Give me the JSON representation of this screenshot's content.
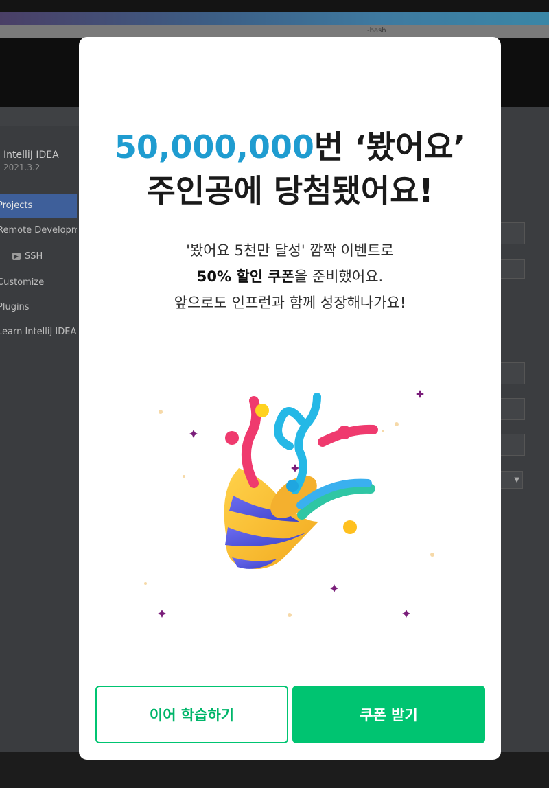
{
  "background": {
    "terminal_title": "-bash",
    "ide": {
      "product_name": "IntelliJ IDEA",
      "version": "2021.3.2",
      "nav_items": [
        {
          "label": "Projects",
          "active": true
        },
        {
          "label": "Remote Development"
        },
        {
          "label": "SSH",
          "icon": "ssh-icon"
        },
        {
          "label": "Customize"
        },
        {
          "label": "Plugins"
        },
        {
          "label": "Learn IntelliJ IDEA"
        }
      ]
    }
  },
  "modal": {
    "headline": {
      "count": "50,000,000",
      "line1_rest": "번 ‘봤어요’",
      "line2": "주인공에 당첨됐어요!"
    },
    "description": {
      "line1": "'봤어요 5천만 달성' 깜짝 이벤트로",
      "line2_bold": "50% 할인 쿠폰",
      "line2_rest": "을 준비했어요.",
      "line3": "앞으로도 인프런과 함께 성장해나가요!"
    },
    "illustration_icon": "party-popper-icon",
    "buttons": {
      "continue_learning": "이어 학습하기",
      "get_coupon": "쿠폰 받기"
    }
  },
  "colors": {
    "accent_blue": "#1f9cd0",
    "primary_green": "#00c471",
    "overlay_dark": "#141414"
  }
}
